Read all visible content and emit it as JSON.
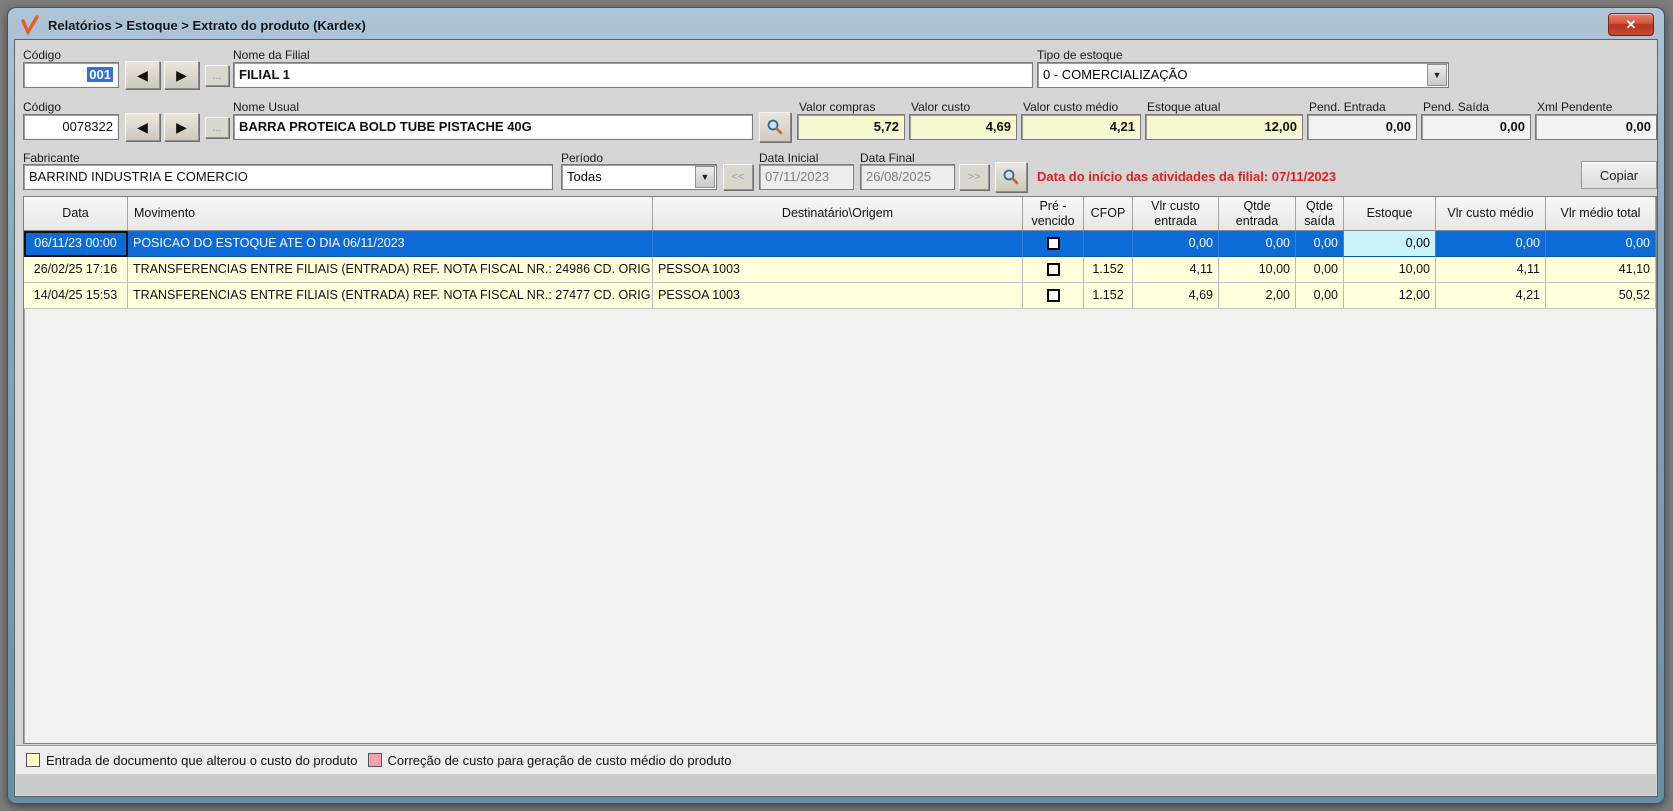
{
  "window": {
    "title": "Relatórios > Estoque > Extrato do produto (Kardex)"
  },
  "glyphs": {
    "prev": "◀",
    "next": "▶",
    "more": "...",
    "combo_arrow": "▼",
    "close": "✕",
    "prev_period": "<<",
    "next_period": ">>"
  },
  "filial": {
    "codigo_label": "Código",
    "codigo_value": "001",
    "nome_label": "Nome da Filial",
    "nome_value": "FILIAL 1",
    "tipo_label": "Tipo de estoque",
    "tipo_value": "0 - COMERCIALIZAÇÃO"
  },
  "produto": {
    "codigo_label": "Código",
    "codigo_value": "0078322",
    "nome_label": "Nome Usual",
    "nome_value": "BARRA PROTEICA BOLD TUBE PISTACHE 40G",
    "valores": [
      {
        "label": "Valor compras",
        "value": "5,72"
      },
      {
        "label": "Valor custo",
        "value": "4,69"
      },
      {
        "label": "Valor custo médio",
        "value": "4,21"
      },
      {
        "label": "Estoque atual",
        "value": "12,00"
      },
      {
        "label": "Pend. Entrada",
        "value": "0,00"
      },
      {
        "label": "Pend. Saída",
        "value": "0,00"
      },
      {
        "label": "Xml Pendente",
        "value": "0,00"
      }
    ]
  },
  "filtros": {
    "fabricante_label": "Fabricante",
    "fabricante_value": "BARRIND INDUSTRIA E COMERCIO",
    "periodo_label": "Período",
    "periodo_value": "Todas",
    "data_inicial_label": "Data Inicial",
    "data_inicial_value": "07/11/2023",
    "data_final_label": "Data Final",
    "data_final_value": "26/08/2025",
    "info_text": "Data do início das atividades da filial: 07/11/2023",
    "copiar_label": "Copiar"
  },
  "grid": {
    "columns": [
      "Data",
      "Movimento",
      "Destinatário\\Origem",
      "Pré -\nvencido",
      "CFOP",
      "Vlr custo\nentrada",
      "Qtde\nentrada",
      "Qtde\nsaída",
      "Estoque",
      "Vlr custo médio",
      "Vlr médio total"
    ],
    "rows": [
      {
        "selected": true,
        "cells": [
          "06/11/23 00:00",
          "POSICAO DO ESTOQUE ATE O DIA 06/11/2023",
          "",
          "",
          "0,00",
          "0,00",
          "0,00",
          "0,00",
          "0,00",
          "0,00"
        ]
      },
      {
        "selected": false,
        "cells": [
          "26/02/25 17:16",
          "TRANSFERENCIAS ENTRE FILIAIS (ENTRADA) REF. NOTA FISCAL NR.: 24986   CD. ORIG",
          "PESSOA 1003",
          "1.152",
          "4,11",
          "10,00",
          "0,00",
          "10,00",
          "4,11",
          "41,10"
        ]
      },
      {
        "selected": false,
        "cells": [
          "14/04/25 15:53",
          "TRANSFERENCIAS ENTRE FILIAIS (ENTRADA) REF. NOTA FISCAL NR.: 27477   CD. ORIG",
          "PESSOA 1003",
          "1.152",
          "4,69",
          "2,00",
          "0,00",
          "12,00",
          "4,21",
          "50,52"
        ]
      }
    ]
  },
  "legend": {
    "items": [
      {
        "label": "Entrada de documento que alterou o custo do produto",
        "color": "#fdfdc8"
      },
      {
        "label": "Correção de custo para geração de custo médio do produto",
        "color": "#f5a3ae"
      }
    ]
  }
}
